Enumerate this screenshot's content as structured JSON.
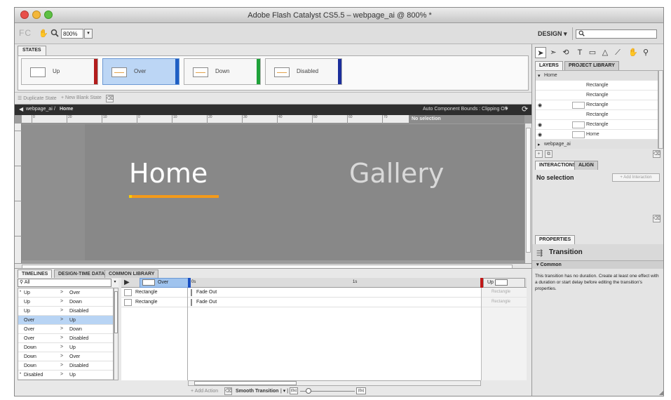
{
  "window": {
    "title": "Adobe Flash Catalyst CS5.5 – webpage_ai @ 800% *"
  },
  "toolbar": {
    "logo": "FC",
    "zoom_value": "800%",
    "workspace": "DESIGN ▾",
    "search_placeholder": ""
  },
  "states": {
    "tab": "STATES",
    "items": [
      {
        "label": "Up",
        "color": "#b31d1d"
      },
      {
        "label": "Over",
        "color": "#1f5fc4"
      },
      {
        "label": "Down",
        "color": "#1fa23a"
      },
      {
        "label": "Disabled",
        "color": "#1c2f9c"
      }
    ],
    "duplicate_label": "☰ Duplicate State",
    "new_blank_label": "+ New Blank State"
  },
  "breadcrumb": {
    "back": "◀",
    "parent": "webpage_ai",
    "separator": "/",
    "current": "Home",
    "bounds_label": "Auto Component Bounds : Clipping Off",
    "bounds_drop": "▾"
  },
  "canvas": {
    "no_selection": "No selection",
    "nav_home": "Home",
    "nav_gallery": "Gallery",
    "ruler_ticks": [
      "0",
      "20",
      "10",
      "0",
      "10",
      "20",
      "30",
      "40",
      "50",
      "60",
      "70",
      "80",
      "90",
      "100"
    ]
  },
  "timelines": {
    "tabs": [
      "TIMELINES",
      "DESIGN-TIME DATA",
      "COMMON LIBRARY"
    ],
    "filter_value": "All",
    "transitions": [
      {
        "bullet": "•",
        "from": "Up",
        "to": "Over",
        "selected": false
      },
      {
        "bullet": "",
        "from": "Up",
        "to": "Down",
        "selected": false
      },
      {
        "bullet": "",
        "from": "Up",
        "to": "Disabled",
        "selected": false
      },
      {
        "bullet": "",
        "from": "Over",
        "to": "Up",
        "selected": true
      },
      {
        "bullet": "",
        "from": "Over",
        "to": "Down",
        "selected": false
      },
      {
        "bullet": "",
        "from": "Over",
        "to": "Disabled",
        "selected": false
      },
      {
        "bullet": "",
        "from": "Down",
        "to": "Up",
        "selected": false
      },
      {
        "bullet": "",
        "from": "Down",
        "to": "Over",
        "selected": false
      },
      {
        "bullet": "",
        "from": "Down",
        "to": "Disabled",
        "selected": false
      },
      {
        "bullet": "•",
        "from": "Disabled",
        "to": "Up",
        "selected": false
      }
    ],
    "arrow": ">",
    "from_state": "Over",
    "to_state": "Up",
    "time_start": "0s",
    "time_mid": "1s",
    "objects": [
      "Rectangle",
      "Rectangle"
    ],
    "actions": [
      "Fade Out",
      "Fade Out"
    ],
    "end_objects": [
      "Rectangle",
      "Rectangle"
    ],
    "add_action": "+ Add Action",
    "smooth_transition": "Smooth Transition",
    "ease_drop": "| ▾ |",
    "duration_start": "(0s)",
    "duration_end": "(0s)"
  },
  "layers": {
    "tabs": [
      "LAYERS",
      "PROJECT LIBRARY"
    ],
    "rows": [
      {
        "label": "Home",
        "group": true,
        "eye": "",
        "thumb": false
      },
      {
        "label": "Rectangle",
        "group": false,
        "eye": "",
        "thumb": false
      },
      {
        "label": "Rectangle",
        "group": false,
        "eye": "",
        "thumb": false
      },
      {
        "label": "Rectangle",
        "group": false,
        "eye": "◉",
        "thumb": true
      },
      {
        "label": "Rectangle",
        "group": false,
        "eye": "",
        "thumb": false
      },
      {
        "label": "Rectangle",
        "group": false,
        "eye": "◉",
        "thumb": true
      },
      {
        "label": "Home",
        "group": false,
        "eye": "◉",
        "thumb": true
      },
      {
        "label": "webpage_ai",
        "group": true,
        "eye": "",
        "thumb": false
      }
    ]
  },
  "interactions": {
    "tabs": [
      "INTERACTIONS",
      "ALIGN"
    ],
    "no_selection": "No selection",
    "add_button": "+ Add Interaction"
  },
  "properties": {
    "tab": "PROPERTIES",
    "title": "Transition",
    "section": "▾ Common",
    "message": "This transition has no duration. Create at least one effect with a duration or start delay before editing the transition's properties."
  }
}
